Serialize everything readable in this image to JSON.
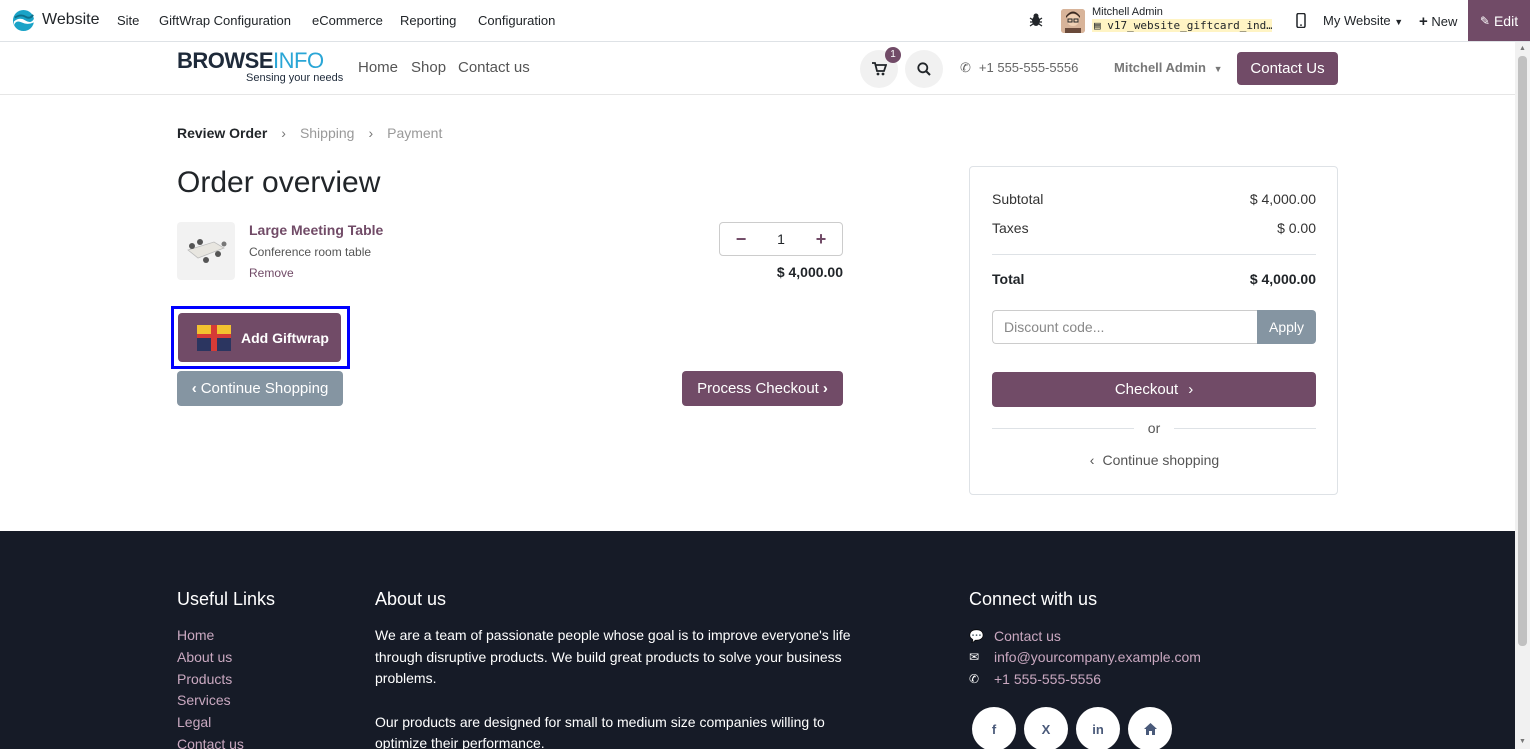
{
  "topbar": {
    "app_name": "Website",
    "menu": [
      "Site",
      "GiftWrap Configuration",
      "eCommerce",
      "Reporting",
      "Configuration"
    ],
    "user_name": "Mitchell Admin",
    "db_name": "v17_website_giftcard_ind…",
    "website_switch": "My Website",
    "new_label": "New",
    "edit_label": "Edit"
  },
  "header": {
    "brand_part1": "BROWSE",
    "brand_part2": "INFO",
    "brand_tagline": "Sensing your needs",
    "nav": [
      "Home",
      "Shop",
      "Contact us"
    ],
    "cart_count": "1",
    "phone": "+1 555-555-5556",
    "user": "Mitchell Admin",
    "contact_button": "Contact Us"
  },
  "steps": {
    "review": "Review Order",
    "shipping": "Shipping",
    "payment": "Payment"
  },
  "order": {
    "title": "Order overview",
    "product_name": "Large Meeting Table",
    "product_desc": "Conference room table",
    "remove": "Remove",
    "quantity": "1",
    "line_price": "$ 4,000.00",
    "giftwrap_button": "Add Giftwrap",
    "continue_button": "Continue Shopping",
    "process_button": "Process Checkout"
  },
  "summary": {
    "subtotal_label": "Subtotal",
    "subtotal_value": "$ 4,000.00",
    "taxes_label": "Taxes",
    "taxes_value": "$ 0.00",
    "total_label": "Total",
    "total_value": "$ 4,000.00",
    "discount_placeholder": "Discount code...",
    "apply": "Apply",
    "checkout": "Checkout",
    "or": "or",
    "continue_link": "Continue shopping"
  },
  "footer": {
    "links_title": "Useful Links",
    "links": [
      "Home",
      "About us",
      "Products",
      "Services",
      "Legal",
      "Contact us"
    ],
    "about_title": "About us",
    "about_p1": "We are a team of passionate people whose goal is to improve everyone's life through disruptive products. We build great products to solve your business problems.",
    "about_p2": "Our products are designed for small to medium size companies willing to optimize their performance.",
    "connect_title": "Connect with us",
    "contact_link": "Contact us",
    "email": "info@yourcompany.example.com",
    "phone": "+1 555-555-5556",
    "social": [
      "f",
      "X",
      "in",
      "home"
    ]
  },
  "colors": {
    "primary": "#714b67",
    "secondary": "#8595a2",
    "footer_bg": "#161b27",
    "focus_outline": "#0000ff"
  }
}
